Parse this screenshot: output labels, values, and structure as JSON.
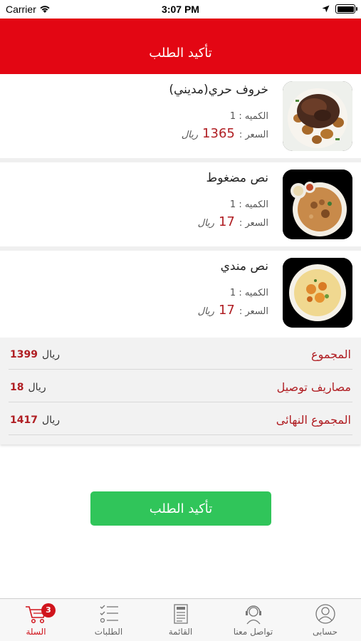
{
  "status_bar": {
    "carrier": "Carrier",
    "time": "3:07 PM"
  },
  "header": {
    "title": "تأكيد الطلب"
  },
  "items": [
    {
      "name": "خروف حري(مديني)",
      "qty_label": "الكميه : 1",
      "price_label": "السعر :",
      "price": "1365",
      "currency": "ريال",
      "image_icon": "roasted-lamb-dish"
    },
    {
      "name": "نص مضغوط",
      "qty_label": "الكميه : 1",
      "price_label": "السعر :",
      "price": "17",
      "currency": "ريال",
      "image_icon": "rice-madghout-dish"
    },
    {
      "name": "نص مندي",
      "qty_label": "الكميه : 1",
      "price_label": "السعر :",
      "price": "17",
      "currency": "ريال",
      "image_icon": "mandi-rice-dish"
    }
  ],
  "totals": [
    {
      "label": "المجموع",
      "amount": "1399",
      "currency": "ريال"
    },
    {
      "label": "مصاريف توصيل",
      "amount": "18",
      "currency": "ريال"
    },
    {
      "label": "المجموع النهائى",
      "amount": "1417",
      "currency": "ريال"
    }
  ],
  "confirm_button": {
    "label": "تأكيد الطلب"
  },
  "tabbar": {
    "tabs": [
      {
        "label": "حسابى",
        "icon": "user-icon"
      },
      {
        "label": "تواصل معنا",
        "icon": "headset-icon"
      },
      {
        "label": "القائمة",
        "icon": "menu-card-icon"
      },
      {
        "label": "الطلبات",
        "icon": "checklist-icon"
      },
      {
        "label": "السلة",
        "icon": "cart-icon",
        "badge": "3",
        "active": true
      }
    ]
  },
  "colors": {
    "primary_red": "#e30613",
    "price_red": "#b01e23",
    "confirm_green": "#30c55a"
  }
}
